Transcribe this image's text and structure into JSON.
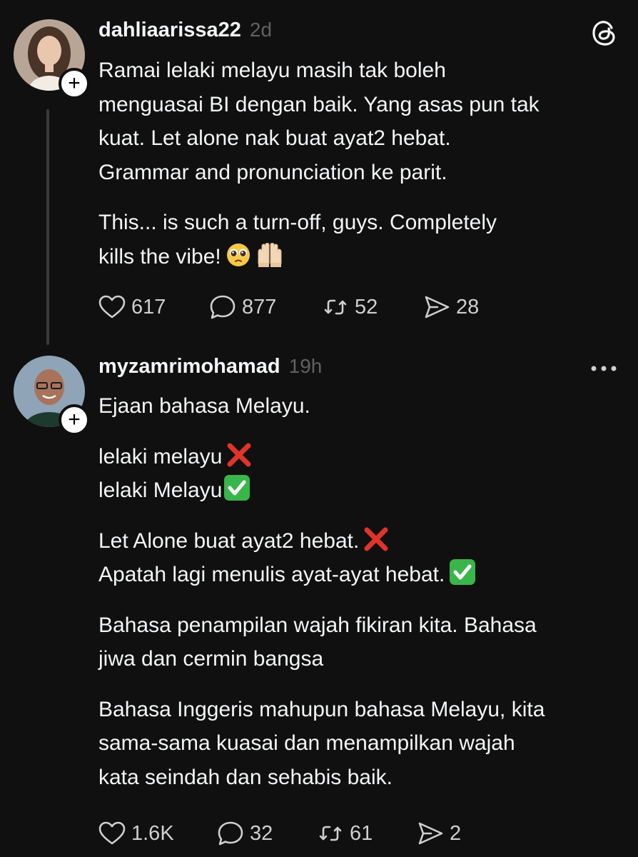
{
  "posts": [
    {
      "username": "dahliaarissa22",
      "time": "2d",
      "lines": [
        "Ramai lelaki melayu masih tak boleh",
        "menguasai BI dengan baik. Yang asas pun tak",
        "kuat. Let alone nak buat ayat2 hebat.",
        "Grammar and pronunciation ke parit."
      ],
      "lines2": [
        "This... is such a turn-off, guys. Completely",
        "kills the vibe!"
      ],
      "actions": {
        "likes": "617",
        "comments": "877",
        "reposts": "52",
        "shares": "28"
      }
    },
    {
      "username": "myzamrimohamad",
      "time": "19h",
      "p1": "Ejaan bahasa Melayu.",
      "p2a": "lelaki melayu",
      "p2b": "lelaki Melayu",
      "p3a": "Let Alone buat ayat2 hebat.",
      "p3b": "Apatah lagi menulis ayat-ayat hebat.",
      "p4": [
        "Bahasa penampilan wajah fikiran kita. Bahasa",
        "jiwa dan cermin bangsa"
      ],
      "p5": [
        "Bahasa Inggeris mahupun bahasa Melayu, kita",
        "sama-sama kuasai dan menampilkan wajah",
        "kata seindah dan sehabis baik."
      ],
      "actions": {
        "likes": "1.6K",
        "comments": "32",
        "reposts": "61",
        "shares": "2"
      }
    }
  ],
  "colors": {
    "background": "#101010",
    "text": "#f3f5f7",
    "muted": "#616161",
    "cross": "#e0342b",
    "check": "#39b54a"
  },
  "icons": [
    "threads-logo-icon",
    "more-icon",
    "heart-icon",
    "comment-icon",
    "repost-icon",
    "share-icon",
    "plus-icon",
    "cross-mark-icon",
    "check-mark-icon",
    "pleading-face-icon",
    "raising-hands-icon"
  ]
}
